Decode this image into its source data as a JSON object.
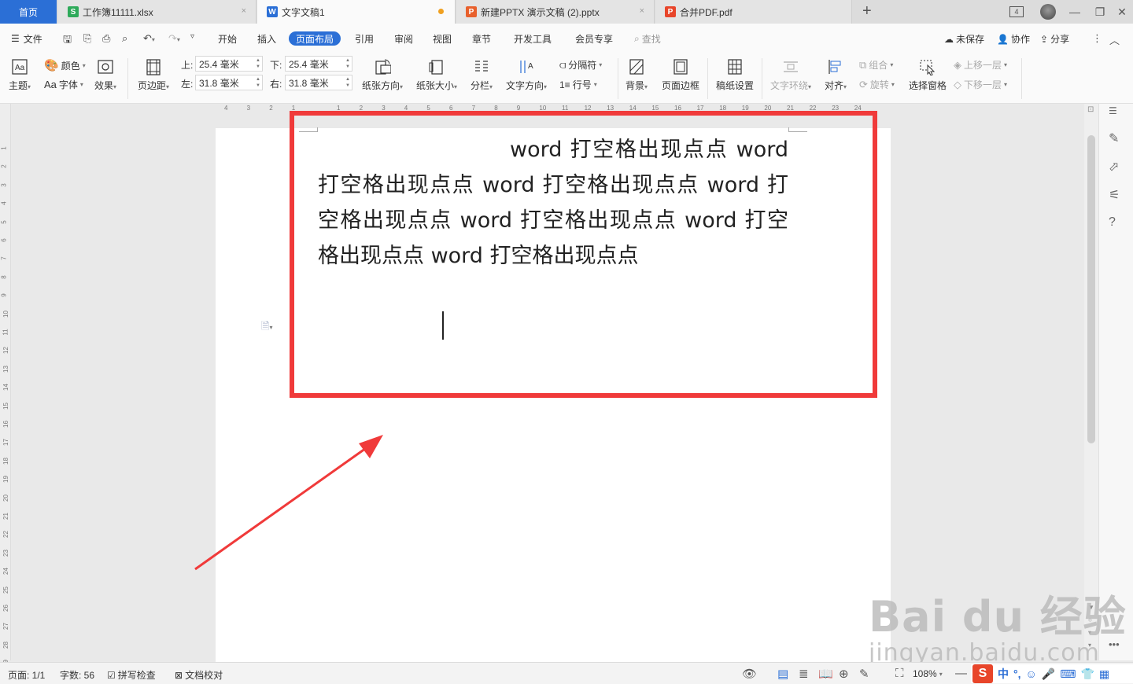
{
  "tabs": {
    "home": "首页",
    "items": [
      {
        "icon_letter": "S",
        "color": "#2eaa5a",
        "label": "工作簿11111.xlsx",
        "close": "×"
      },
      {
        "icon_letter": "W",
        "color": "#2b6fd6",
        "label": "文字文稿1",
        "close": ""
      },
      {
        "icon_letter": "P",
        "color": "#e8602c",
        "label": "新建PPTX 演示文稿 (2).pptx",
        "close": "×"
      },
      {
        "icon_letter": "P",
        "color": "#e8452a",
        "label": "合并PDF.pdf",
        "close": ""
      }
    ],
    "add": "+",
    "badge": "4"
  },
  "menu": {
    "file": "文件",
    "items": [
      "开始",
      "插入",
      "页面布局",
      "引用",
      "审阅",
      "视图",
      "章节",
      "开发工具",
      "会员专享"
    ],
    "active": "页面布局",
    "search": "查找",
    "unsaved": "未保存",
    "collab": "协作",
    "share": "分享"
  },
  "ribbon": {
    "theme": "主题",
    "color": "颜色",
    "font": "字体",
    "effect": "效果",
    "margins": "页边距",
    "top_label": "上:",
    "top_value": "25.4 毫米",
    "bottom_label": "下:",
    "bottom_value": "25.4 毫米",
    "left_label": "左:",
    "left_value": "31.8 毫米",
    "right_label": "右:",
    "right_value": "31.8 毫米",
    "orientation": "纸张方向",
    "size": "纸张大小",
    "columns": "分栏",
    "text_direction": "文字方向",
    "breaks": "分隔符",
    "line_numbers": "行号",
    "background": "背景",
    "page_border": "页面边框",
    "manuscript": "稿纸设置",
    "wrap": "文字环绕",
    "align": "对齐",
    "group": "组合",
    "rotate": "旋转",
    "selection_pane": "选择窗格",
    "bring_forward": "上移一层",
    "send_backward": "下移一层"
  },
  "ruler": {
    "h_ticks": [
      "4",
      "3",
      "2",
      "1",
      "",
      "1",
      "2",
      "3",
      "4",
      "5",
      "6",
      "7",
      "8",
      "9",
      "10",
      "11",
      "12",
      "13",
      "14",
      "15",
      "16",
      "17",
      "18",
      "19",
      "20",
      "21",
      "22",
      "23",
      "24"
    ],
    "v_ticks": [
      "1",
      "2",
      "3",
      "4",
      "5",
      "6",
      "7",
      "8",
      "9",
      "10",
      "11",
      "12",
      "13",
      "14",
      "15",
      "16",
      "17",
      "18",
      "19",
      "20",
      "21",
      "22",
      "23",
      "24",
      "25",
      "26",
      "27",
      "28",
      "29"
    ]
  },
  "document": {
    "text": "word 打空格出现点点 word 打空格出现点点 word 打空格出现点点 word 打空格出现点点 word 打空格出现点点 word 打空格出现点点 word 打空格出现点点"
  },
  "watermark": {
    "brand": "Bai du 经验",
    "url": "jingyan.baidu.com"
  },
  "status": {
    "page": "页面: 1/1",
    "words": "字数: 56",
    "spell": "拼写检查",
    "proofread": "文档校对",
    "zoom": "108%"
  },
  "ime": {
    "logo": "S",
    "lang": "中"
  },
  "colors": {
    "accent": "#2b6fd6",
    "highlight_box": "#f03a3a",
    "arrow": "#f03a3a"
  }
}
